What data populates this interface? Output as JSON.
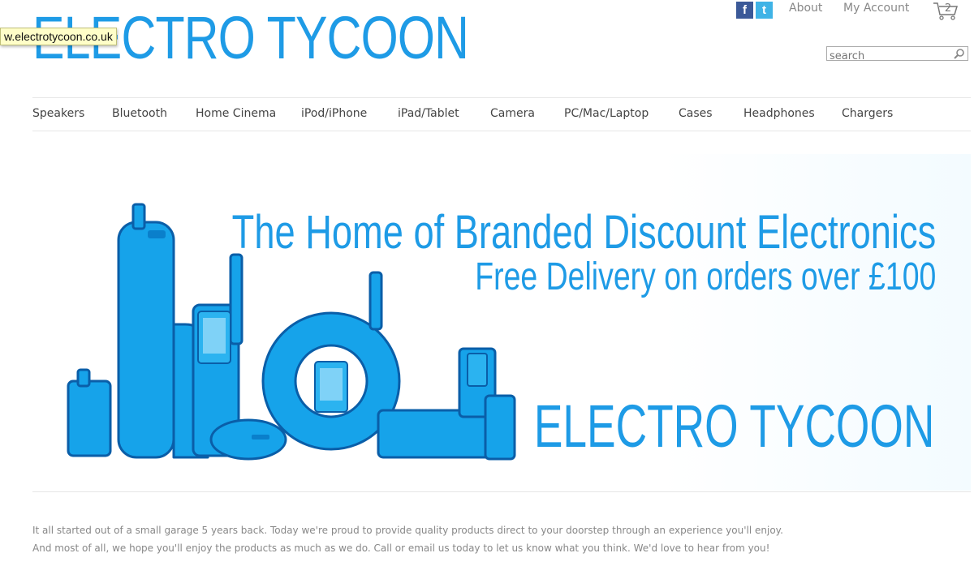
{
  "site": {
    "logo_text": "ELECTRO TYCOON",
    "url_tooltip": "w.electrotycoon.co.uk"
  },
  "top_links": {
    "about": "About",
    "my_account": "My Account",
    "cart_count": "2"
  },
  "social": {
    "facebook": "f",
    "twitter": "t"
  },
  "search": {
    "placeholder": "search"
  },
  "nav": {
    "items": [
      {
        "label": "Speakers"
      },
      {
        "label": "Bluetooth"
      },
      {
        "label": "Home Cinema"
      },
      {
        "label": "iPod/iPhone"
      },
      {
        "label": "iPad/Tablet"
      },
      {
        "label": "Camera"
      },
      {
        "label": "PC/Mac/Laptop"
      },
      {
        "label": "Cases"
      },
      {
        "label": "Headphones"
      },
      {
        "label": "Chargers"
      }
    ]
  },
  "banner": {
    "headline": "The Home of Branded Discount Electronics",
    "subline": "Free Delivery on orders over £100",
    "brand": "ELECTRO TYCOON"
  },
  "about": {
    "line1": "It all started out of a small garage 5 years back. Today we're proud to provide quality products direct to your doorstep through an experience you'll enjoy.",
    "line2": "And most of all, we hope you'll enjoy the products as much as we do. Call or email us today to let us know what you think. We'd love to hear from you!"
  },
  "colors": {
    "brand_blue": "#1e9be6",
    "facebook_blue": "#3b5998",
    "twitter_blue": "#3fb3e6"
  }
}
